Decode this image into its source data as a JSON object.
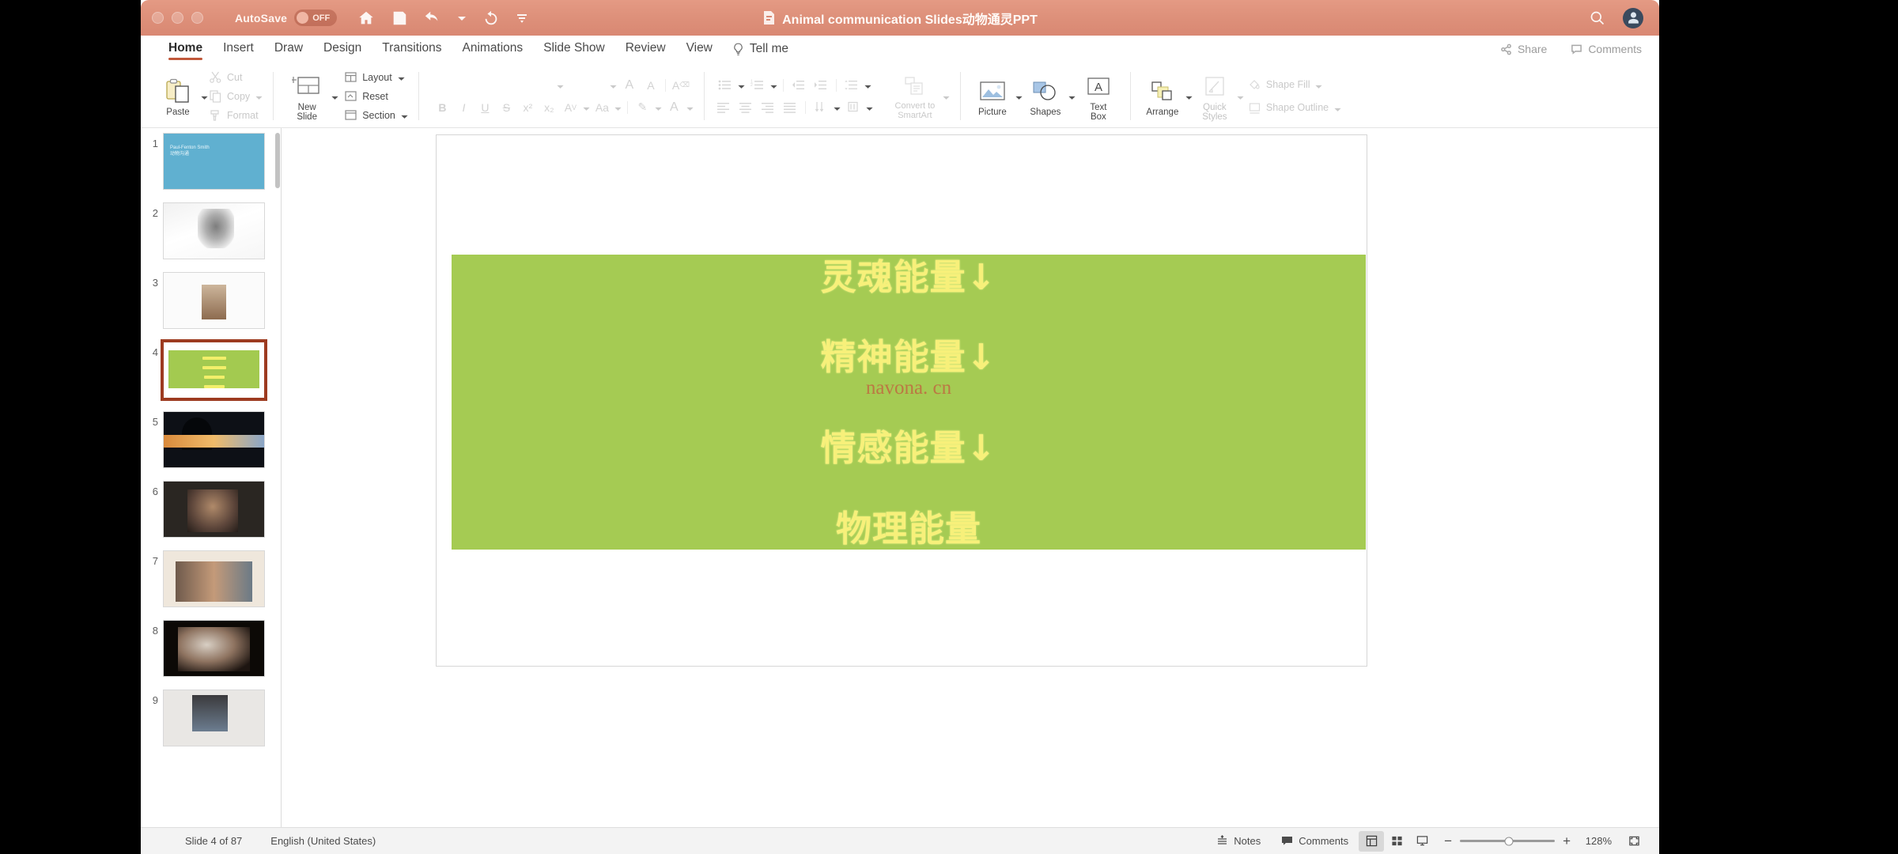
{
  "window": {
    "title": "Animal communication Slides动物通灵PPT",
    "autosave_label": "AutoSave",
    "autosave_state": "OFF",
    "accent_color": "#d98873",
    "tab_underline_color": "#c0583a"
  },
  "titlebar_icons": [
    "home-icon",
    "save-icon",
    "undo-icon",
    "redo-icon",
    "customize-toolbar-icon"
  ],
  "titlebar_right": [
    "search-icon",
    "account-avatar"
  ],
  "ribbon_tabs": [
    {
      "label": "Home",
      "active": true
    },
    {
      "label": "Insert",
      "active": false
    },
    {
      "label": "Draw",
      "active": false
    },
    {
      "label": "Design",
      "active": false
    },
    {
      "label": "Transitions",
      "active": false
    },
    {
      "label": "Animations",
      "active": false
    },
    {
      "label": "Slide Show",
      "active": false
    },
    {
      "label": "Review",
      "active": false
    },
    {
      "label": "View",
      "active": false
    }
  ],
  "tell_me": "Tell me",
  "tabs_right": [
    {
      "label": "Share",
      "icon": "share-icon"
    },
    {
      "label": "Comments",
      "icon": "comment-icon"
    }
  ],
  "ribbon": {
    "clipboard": {
      "paste": "Paste",
      "cut": "Cut",
      "copy": "Copy",
      "format": "Format"
    },
    "slides": {
      "new_slide": "New\nSlide",
      "new_slide_line1": "New",
      "new_slide_line2": "Slide",
      "layout": "Layout",
      "reset": "Reset",
      "section": "Section"
    },
    "drawing": {
      "convert_line1": "Convert to",
      "convert_line2": "SmartArt",
      "picture": "Picture",
      "shapes": "Shapes",
      "text_box_line1": "Text",
      "text_box_line2": "Box",
      "arrange": "Arrange",
      "quick_styles_line1": "Quick",
      "quick_styles_line2": "Styles",
      "shape_fill": "Shape Fill",
      "shape_outline": "Shape Outline"
    },
    "font_buttons": [
      "bold",
      "italic",
      "underline",
      "strikethrough",
      "superscript",
      "subscript",
      "character-spacing",
      "change-case",
      "text-highlight",
      "font-color"
    ]
  },
  "thumbnails": {
    "scrollbar": "thumbnail-scrollbar",
    "slides": [
      {
        "number": "1",
        "kind": "title",
        "title_line1": "Paul-Fenton Smith",
        "title_line2": "动物沟通",
        "selected": false
      },
      {
        "number": "2",
        "kind": "photo-cat",
        "selected": false
      },
      {
        "number": "3",
        "kind": "photo-3",
        "selected": false
      },
      {
        "number": "4",
        "kind": "green-list",
        "selected": true
      },
      {
        "number": "5",
        "kind": "photo-5",
        "selected": false
      },
      {
        "number": "6",
        "kind": "photo-6",
        "selected": false
      },
      {
        "number": "7",
        "kind": "photo-7",
        "selected": false
      },
      {
        "number": "8",
        "kind": "photo-8",
        "selected": false
      },
      {
        "number": "9",
        "kind": "photo-9",
        "selected": false
      }
    ]
  },
  "slide": {
    "background": "#ffffff",
    "band_color": "#a5cb53",
    "text_color": "#f7f07a",
    "lines": [
      {
        "text": "灵魂能量↓"
      },
      {
        "text": "精神能量↓"
      },
      {
        "text": "情感能量↓"
      },
      {
        "text": "物理能量"
      }
    ],
    "watermark": "navona. cn"
  },
  "statusbar": {
    "slide_count": "Slide 4 of 87",
    "language": "English (United States)",
    "notes": "Notes",
    "comments": "Comments",
    "views": [
      "normal-view",
      "slide-sorter-view",
      "slideshow-view"
    ],
    "zoom_percent": "128%",
    "fit_slide": "fit-to-window-icon"
  },
  "webcam": {
    "label": "presenter-video"
  }
}
